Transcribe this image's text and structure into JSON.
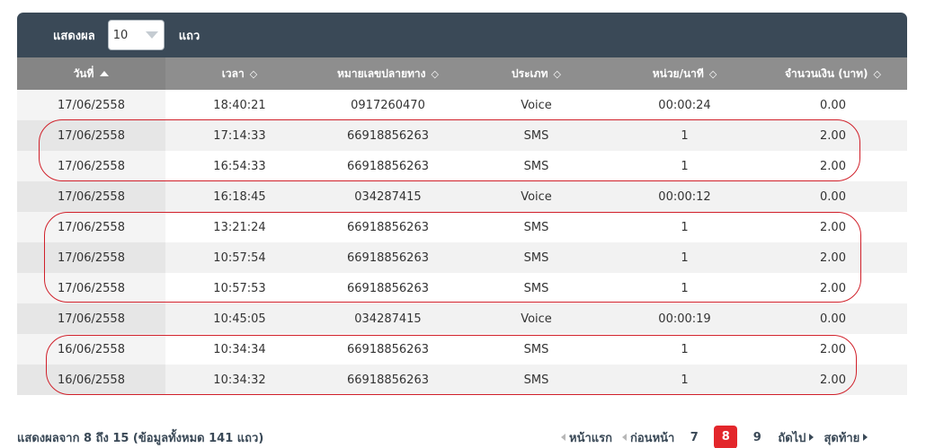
{
  "toolbar": {
    "show_label": "แสดงผล",
    "page_size": "10",
    "rows_label": "แถว"
  },
  "table": {
    "columns": [
      {
        "label": "วันที่",
        "sort": "asc"
      },
      {
        "label": "เวลา",
        "sort": "both"
      },
      {
        "label": "หมายเลขปลายทาง",
        "sort": "both"
      },
      {
        "label": "ประเภท",
        "sort": "both"
      },
      {
        "label": "หน่วย/นาที",
        "sort": "both"
      },
      {
        "label": "จำนวนเงิน (บาท)",
        "sort": "both"
      }
    ],
    "rows": [
      [
        "17/06/2558",
        "18:40:21",
        "0917260470",
        "Voice",
        "00:00:24",
        "0.00"
      ],
      [
        "17/06/2558",
        "17:14:33",
        "66918856263",
        "SMS",
        "1",
        "2.00"
      ],
      [
        "17/06/2558",
        "16:54:33",
        "66918856263",
        "SMS",
        "1",
        "2.00"
      ],
      [
        "17/06/2558",
        "16:18:45",
        "034287415",
        "Voice",
        "00:00:12",
        "0.00"
      ],
      [
        "17/06/2558",
        "13:21:24",
        "66918856263",
        "SMS",
        "1",
        "2.00"
      ],
      [
        "17/06/2558",
        "10:57:54",
        "66918856263",
        "SMS",
        "1",
        "2.00"
      ],
      [
        "17/06/2558",
        "10:57:53",
        "66918856263",
        "SMS",
        "1",
        "2.00"
      ],
      [
        "17/06/2558",
        "10:45:05",
        "034287415",
        "Voice",
        "00:00:19",
        "0.00"
      ],
      [
        "16/06/2558",
        "10:34:34",
        "66918856263",
        "SMS",
        "1",
        "2.00"
      ],
      [
        "16/06/2558",
        "10:34:32",
        "66918856263",
        "SMS",
        "1",
        "2.00"
      ]
    ]
  },
  "highlight_color": "#d0202a",
  "footer": {
    "info": "แสดงผลจาก 8 ถึง 15 (ข้อมูลทั้งหมด 141 แถว)",
    "first": "หน้าแรก",
    "prev": "ก่อนหน้า",
    "pages": [
      "7",
      "8",
      "9"
    ],
    "current_page": "8",
    "next": "ถัดไป",
    "last": "สุดท้าย"
  }
}
